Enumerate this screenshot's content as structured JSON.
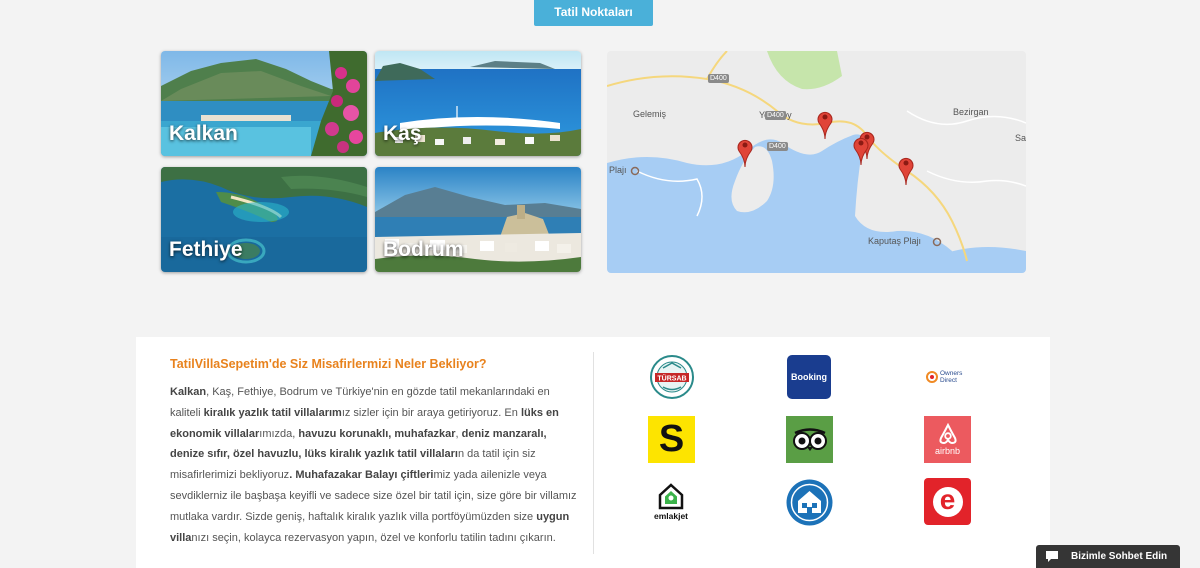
{
  "tab": {
    "label": "Tatil Noktaları"
  },
  "destinations": [
    {
      "name": "Kalkan"
    },
    {
      "name": "Kaş"
    },
    {
      "name": "Fethiye"
    },
    {
      "name": "Bodrum"
    }
  ],
  "map": {
    "place_labels": [
      "Yeşilköy",
      "Gelemiş",
      "Bezirgan",
      "Plajı",
      "Kaputaş Plajı",
      "Sa"
    ],
    "road_labels": [
      "D400",
      "D400",
      "D400"
    ],
    "pin_count": 5
  },
  "info": {
    "title": "TatilVillaSepetim'de Siz Misafirlermizi Neler Bekliyor?",
    "paragraph": [
      {
        "t": " ",
        "b": false
      },
      {
        "t": "Kalkan",
        "b": true
      },
      {
        "t": ", Kaş, Fethiye, Bodrum ve Türkiye'nin en gözde tatil mekanlarındaki en kaliteli ",
        "b": false
      },
      {
        "t": "kiralık yazlık tatil villalarım",
        "b": true
      },
      {
        "t": "ız sizler için bir araya  getiriyoruz. En ",
        "b": false
      },
      {
        "t": "lüks en ekonomik villalar",
        "b": true
      },
      {
        "t": "ımızda, ",
        "b": false
      },
      {
        "t": "havuzu korunaklı, muhafazkar",
        "b": true
      },
      {
        "t": ", ",
        "b": false
      },
      {
        "t": "deniz manzaralı, denize sıfır, özel havuzlu, lüks kiralık yazlık tatil villaları",
        "b": true
      },
      {
        "t": "n da tatil için siz misafirlerimizi bekliyoruz",
        "b": false
      },
      {
        "t": ".",
        "b": true
      },
      {
        "t": " ",
        "b": false
      },
      {
        "t": "Muhafazakar Balayı  çiftleri",
        "b": true
      },
      {
        "t": "miz yada ailenizle  veya sevdiklerniz ile başbaşa keyifli ve sadece size özel bir tatil için, size göre bir villamız mutlaka vardır.  Sizde geniş, haftalık kiralık yazlık villa portföyümüzden size ",
        "b": false
      },
      {
        "t": "uygun villa",
        "b": true
      },
      {
        "t": "nızı seçin, kolayca rezervasyon yapın, özel ve konforlu tatilin tadını çıkarın.",
        "b": false
      }
    ]
  },
  "partners": [
    {
      "name": "TÜRSAB",
      "icon": "tursab-logo"
    },
    {
      "name": "Booking",
      "icon": "booking-logo",
      "color": "#1a3d8f"
    },
    {
      "name": "Owners Direct",
      "icon": "owners-direct-logo"
    },
    {
      "name": "S",
      "icon": "s-logo",
      "color": "#fde400"
    },
    {
      "name": "TripAdvisor",
      "icon": "tripadvisor-logo",
      "color": "#5a9e45"
    },
    {
      "name": "airbnb",
      "icon": "airbnb-logo",
      "color": "#ec5a5f"
    },
    {
      "name": "emlakjet",
      "icon": "emlakjet-logo"
    },
    {
      "name": "HomeAway",
      "icon": "homeaway-logo",
      "color": "#1c72b8"
    },
    {
      "name": "e",
      "icon": "emlak-e-logo",
      "color": "#e2232a"
    }
  ],
  "chat": {
    "label": "Bizimle Sohbet Edin",
    "icon": "chat-bubble-icon"
  },
  "colors": {
    "accent": "#4ab0d9",
    "title": "#e8821d",
    "chat_bg": "#353535"
  }
}
